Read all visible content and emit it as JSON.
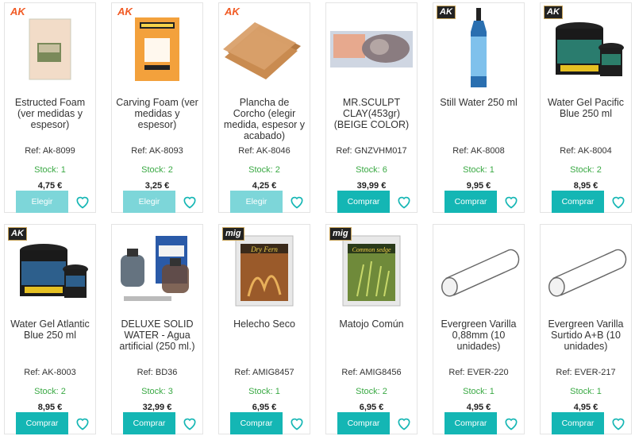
{
  "products": [
    {
      "brand": "AK",
      "title": "Estructed Foam (ver medidas y espesor)",
      "ref": "Ref: Ak-8099",
      "stock": "Stock: 1",
      "price": "4,75 €",
      "button": "Elegir",
      "image": "foam-sheet"
    },
    {
      "brand": "AK",
      "title": "Carving Foam (ver medidas y espesor)",
      "ref": "Ref: AK-8093",
      "stock": "Stock: 2",
      "price": "3,25 €",
      "button": "Elegir",
      "image": "carving-foam-pack"
    },
    {
      "brand": "AK",
      "title": "Plancha de Corcho (elegir medida, espesor y acabado)",
      "ref": "Ref: AK-8046",
      "stock": "Stock: 2",
      "price": "4,25 €",
      "button": "Elegir",
      "image": "cork-sheets"
    },
    {
      "brand": "",
      "title": "MR.SCULPT CLAY(453gr) (BEIGE COLOR)",
      "ref": "Ref: GNZVHM017",
      "stock": "Stock: 6",
      "price": "39,99 €",
      "button": "Comprar",
      "image": "clay-box"
    },
    {
      "brand": "AK",
      "title": "Still Water 250 ml",
      "ref": "Ref: AK-8008",
      "stock": "Stock: 1",
      "price": "9,95 €",
      "button": "Comprar",
      "image": "still-water-bottle"
    },
    {
      "brand": "AK",
      "title": "Water Gel Pacific Blue 250 ml",
      "ref": "Ref: AK-8004",
      "stock": "Stock: 2",
      "price": "8,95 €",
      "button": "Comprar",
      "image": "water-gel-jar"
    },
    {
      "brand": "AK",
      "title": "Water Gel Atlantic Blue 250 ml",
      "ref": "Ref: AK-8003",
      "stock": "Stock: 2",
      "price": "8,95 €",
      "button": "Comprar",
      "image": "water-gel-jar"
    },
    {
      "brand": "",
      "title": "DELUXE SOLID WATER - Agua artificial (250 ml.)",
      "ref": "Ref: BD36",
      "stock": "Stock: 3",
      "price": "32,99 €",
      "button": "Comprar",
      "image": "solid-water-kit"
    },
    {
      "brand": "mig",
      "title": "Helecho Seco",
      "ref": "Ref: AMIG8457",
      "stock": "Stock: 1",
      "price": "6,95 €",
      "button": "Comprar",
      "image": "dry-fern-pack",
      "pack_label": "Dry Fern"
    },
    {
      "brand": "mig",
      "title": "Matojo Común",
      "ref": "Ref: AMIG8456",
      "stock": "Stock: 2",
      "price": "6,95 €",
      "button": "Comprar",
      "image": "common-sedge-pack",
      "pack_label": "Common sedge"
    },
    {
      "brand": "",
      "title": "Evergreen Varilla 0,88mm (10 unidades)",
      "ref": "Ref: EVER-220",
      "stock": "Stock: 1",
      "price": "4,95 €",
      "button": "Comprar",
      "image": "rod"
    },
    {
      "brand": "",
      "title": "Evergreen Varilla Surtido A+B (10 unidades)",
      "ref": "Ref: EVER-217",
      "stock": "Stock: 1",
      "price": "4,95 €",
      "button": "Comprar",
      "image": "rod"
    }
  ],
  "colors": {
    "buy": "#14b6b4",
    "choose": "#7dd6d9",
    "stock": "#3aa944",
    "ak": "#f15a24"
  }
}
